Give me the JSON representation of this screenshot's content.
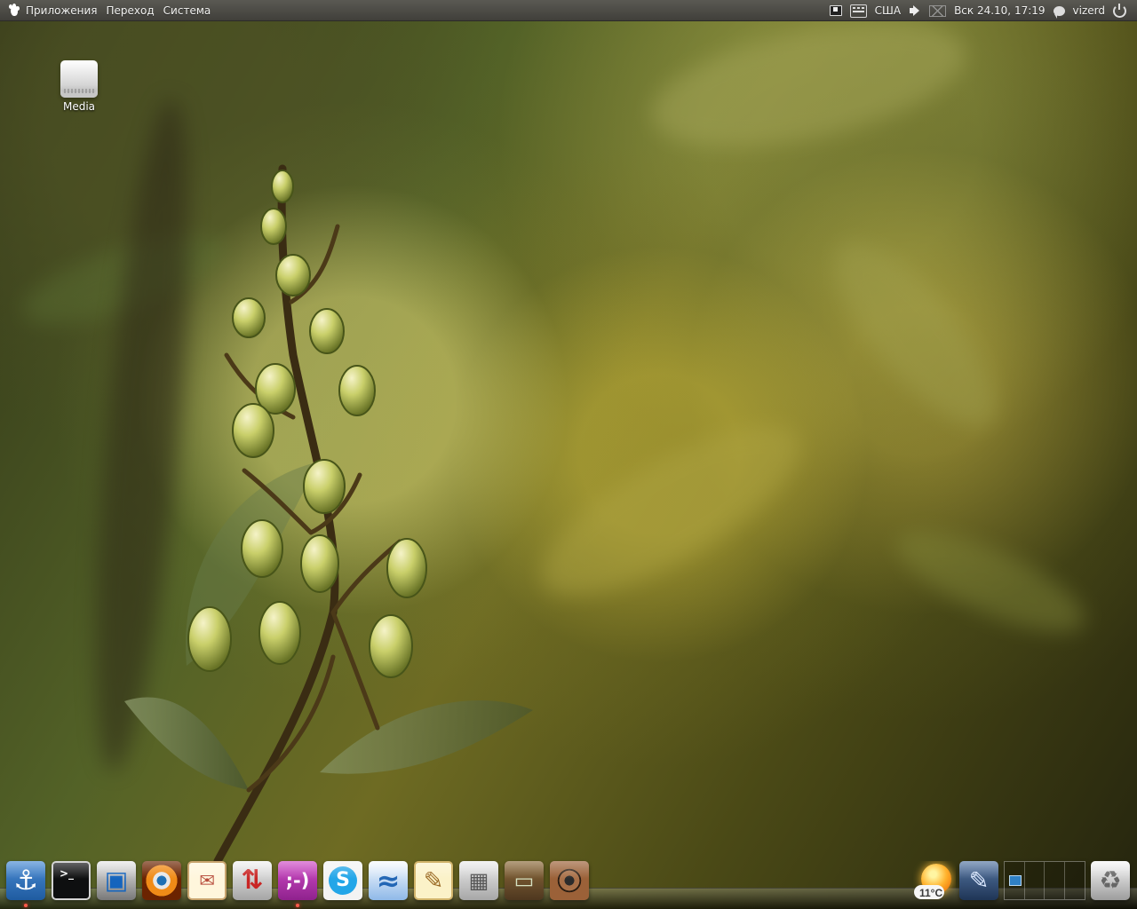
{
  "top_panel": {
    "menus": [
      "Приложения",
      "Переход",
      "Система"
    ],
    "keyboard_layout": "США",
    "datetime": "Вск 24.10, 17:19",
    "user": "vizerd"
  },
  "desktop": {
    "icons": [
      {
        "label": "Media",
        "icon": "drive-icon"
      }
    ]
  },
  "dock": {
    "launchers": [
      {
        "icon": "anchor-icon",
        "glyph": "⚓",
        "running": true
      },
      {
        "icon": "terminal-icon",
        "glyph": ">_",
        "running": false
      },
      {
        "icon": "monitor-icon",
        "glyph": "▣",
        "running": false
      },
      {
        "icon": "eye-icon",
        "glyph": "",
        "running": false
      },
      {
        "icon": "mail-icon",
        "glyph": "✉",
        "running": false
      },
      {
        "icon": "transfer-icon",
        "glyph": "⇅",
        "running": false
      },
      {
        "icon": "chat-icon",
        "glyph": ";-)",
        "running": true
      },
      {
        "icon": "skype-icon",
        "glyph": "S",
        "running": false
      },
      {
        "icon": "office-icon",
        "glyph": "≈",
        "running": false
      },
      {
        "icon": "text-editor-icon",
        "glyph": "✎",
        "running": false
      },
      {
        "icon": "calculator-icon",
        "glyph": "▦",
        "running": false
      },
      {
        "icon": "tv-icon",
        "glyph": "▭",
        "running": false
      },
      {
        "icon": "speaker-icon",
        "glyph": "",
        "running": false
      }
    ],
    "weather": {
      "temperature": "11°C",
      "icon": "sunny-cloud-icon"
    },
    "right_items": [
      {
        "icon": "writer-icon",
        "glyph": "✎"
      },
      {
        "icon": "workspace-switcher-icon",
        "workspaces": 4,
        "active": 1
      },
      {
        "icon": "trash-icon",
        "glyph": "♻"
      }
    ]
  },
  "colors": {
    "panel_top": "#5a5953",
    "panel_bottom": "#403f3a",
    "wallpaper_green": "#6e6b23",
    "running_indicator": "#ff5a4a"
  }
}
